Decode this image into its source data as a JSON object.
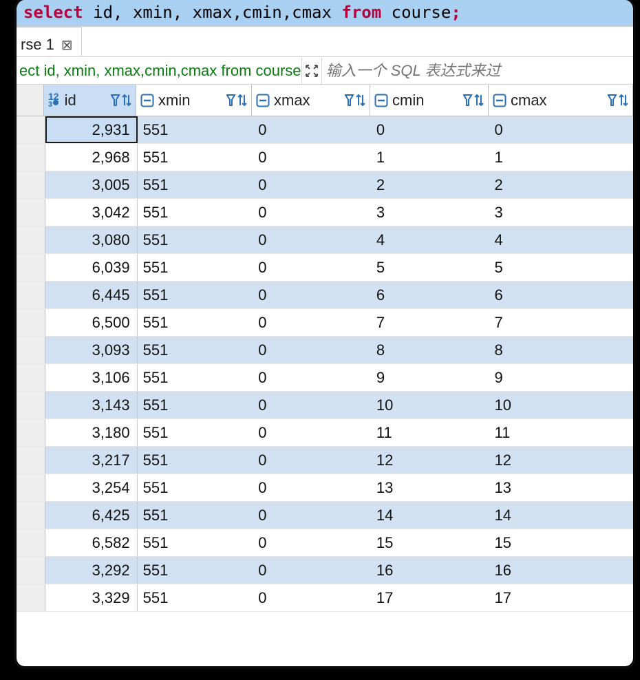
{
  "sql": {
    "select_kw": "select",
    "fields": " id, xmin, xmax,cmin,cmax ",
    "from_kw": "from",
    "table": " course",
    "semicolon": ";"
  },
  "tab": {
    "label": "rse 1",
    "close_glyph": "⊠"
  },
  "crumb": {
    "sql_display": "ect id, xmin, xmax,cmin,cmax from course",
    "filter_placeholder": "输入一个 SQL 表达式来过"
  },
  "columns": [
    {
      "key": "id",
      "label": "id",
      "type": "key",
      "width": "w-id",
      "active": true
    },
    {
      "key": "xmin",
      "label": "xmin",
      "type": "text",
      "width": "w-xmin",
      "active": false
    },
    {
      "key": "xmax",
      "label": "xmax",
      "type": "text",
      "width": "w-xmax",
      "active": false
    },
    {
      "key": "cmin",
      "label": "cmin",
      "type": "text",
      "width": "w-cmin",
      "active": false
    },
    {
      "key": "cmax",
      "label": "cmax",
      "type": "text",
      "width": "w-cmax",
      "active": false
    }
  ],
  "rows": [
    {
      "id": "2,931",
      "xmin": "551",
      "xmax": "0",
      "cmin": "0",
      "cmax": "0",
      "selected": true
    },
    {
      "id": "2,968",
      "xmin": "551",
      "xmax": "0",
      "cmin": "1",
      "cmax": "1",
      "selected": false
    },
    {
      "id": "3,005",
      "xmin": "551",
      "xmax": "0",
      "cmin": "2",
      "cmax": "2",
      "selected": false
    },
    {
      "id": "3,042",
      "xmin": "551",
      "xmax": "0",
      "cmin": "3",
      "cmax": "3",
      "selected": false
    },
    {
      "id": "3,080",
      "xmin": "551",
      "xmax": "0",
      "cmin": "4",
      "cmax": "4",
      "selected": false
    },
    {
      "id": "6,039",
      "xmin": "551",
      "xmax": "0",
      "cmin": "5",
      "cmax": "5",
      "selected": false
    },
    {
      "id": "6,445",
      "xmin": "551",
      "xmax": "0",
      "cmin": "6",
      "cmax": "6",
      "selected": false
    },
    {
      "id": "6,500",
      "xmin": "551",
      "xmax": "0",
      "cmin": "7",
      "cmax": "7",
      "selected": false
    },
    {
      "id": "3,093",
      "xmin": "551",
      "xmax": "0",
      "cmin": "8",
      "cmax": "8",
      "selected": false
    },
    {
      "id": "3,106",
      "xmin": "551",
      "xmax": "0",
      "cmin": "9",
      "cmax": "9",
      "selected": false
    },
    {
      "id": "3,143",
      "xmin": "551",
      "xmax": "0",
      "cmin": "10",
      "cmax": "10",
      "selected": false
    },
    {
      "id": "3,180",
      "xmin": "551",
      "xmax": "0",
      "cmin": "11",
      "cmax": "11",
      "selected": false
    },
    {
      "id": "3,217",
      "xmin": "551",
      "xmax": "0",
      "cmin": "12",
      "cmax": "12",
      "selected": false
    },
    {
      "id": "3,254",
      "xmin": "551",
      "xmax": "0",
      "cmin": "13",
      "cmax": "13",
      "selected": false
    },
    {
      "id": "6,425",
      "xmin": "551",
      "xmax": "0",
      "cmin": "14",
      "cmax": "14",
      "selected": false
    },
    {
      "id": "6,582",
      "xmin": "551",
      "xmax": "0",
      "cmin": "15",
      "cmax": "15",
      "selected": false
    },
    {
      "id": "3,292",
      "xmin": "551",
      "xmax": "0",
      "cmin": "16",
      "cmax": "16",
      "selected": false
    },
    {
      "id": "3,329",
      "xmin": "551",
      "xmax": "0",
      "cmin": "17",
      "cmax": "17",
      "selected": false
    }
  ]
}
